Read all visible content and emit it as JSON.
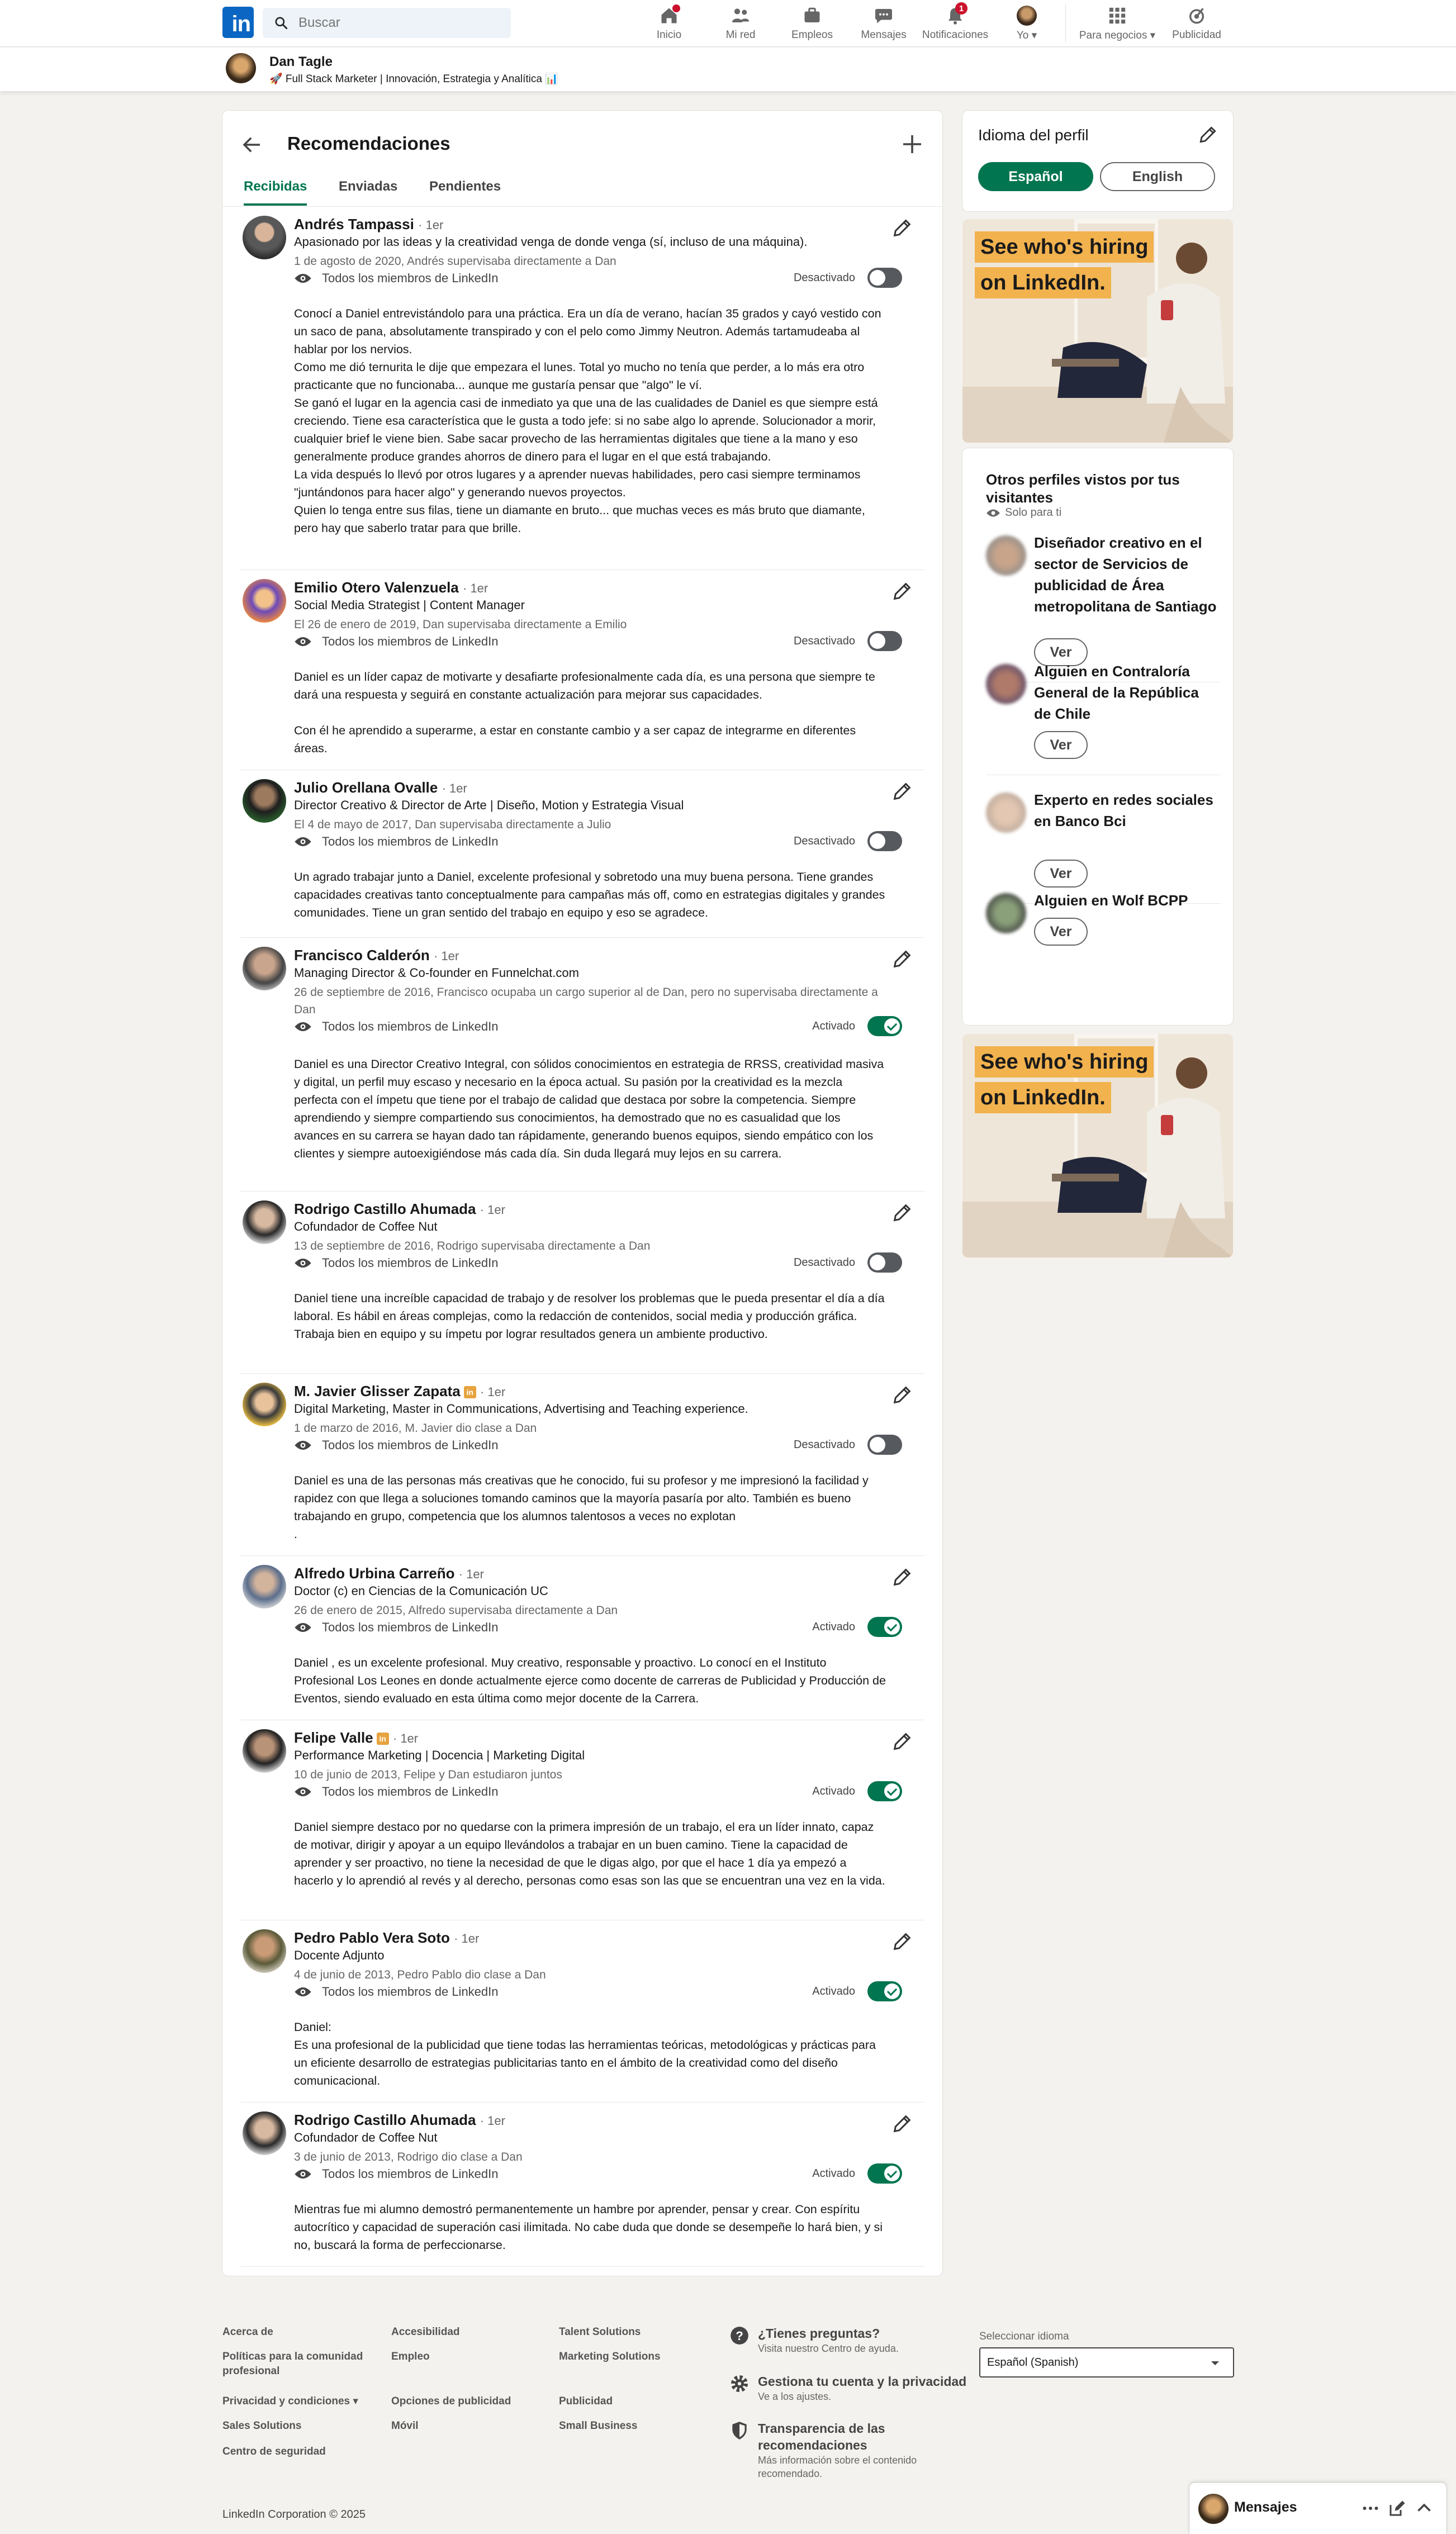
{
  "nav": {
    "logo": "in",
    "search_placeholder": "Buscar",
    "items": [
      {
        "label": "Inicio",
        "icon": "home-icon",
        "badge": ""
      },
      {
        "label": "Mi red",
        "icon": "network-icon",
        "badge": ""
      },
      {
        "label": "Empleos",
        "icon": "briefcase-icon",
        "badge": ""
      },
      {
        "label": "Mensajes",
        "icon": "messaging-icon",
        "badge": ""
      },
      {
        "label": "Notificaciones",
        "icon": "bell-icon",
        "badge": "1"
      },
      {
        "label": "Yo",
        "icon": "avatar",
        "badge": ""
      },
      {
        "label": "Para negocios",
        "icon": "grid-icon",
        "badge": ""
      },
      {
        "label": "Publicidad",
        "icon": "advertise-icon",
        "badge": ""
      }
    ]
  },
  "profile": {
    "name": "Dan Tagle",
    "headline": "🚀 Full Stack Marketer | Innovación, Estrategia y Analítica 📊"
  },
  "main": {
    "title": "Recomendaciones",
    "tabs": [
      "Recibidas",
      "Enviadas",
      "Pendientes"
    ],
    "active_tab": 0,
    "recommendations": [
      {
        "name": "Andrés Tampassi",
        "degree": "· 1er",
        "li_badge": false,
        "headline": "Apasionado por las ideas y la creatividad venga de donde venga (sí, incluso de una máquina).",
        "relation": "1 de agosto de 2020, Andrés supervisaba directamente a Dan",
        "visibility": "Todos los miembros de LinkedIn",
        "state": "Desactivado",
        "on": false,
        "text": "Conocí a Daniel entrevistándolo para una práctica. Era un día de verano, hacían 35 grados y cayó vestido con un saco de pana, absolutamente transpirado y con el pelo como Jimmy Neutron. Además tartamudeaba al hablar por los nervios.\nComo me dió ternurita le dije que empezara el lunes. Total yo mucho no tenía que perder, a lo más era otro practicante que no funcionaba... aunque me gustaría pensar que \"algo\" le ví.\nSe ganó el lugar en la agencia casi de inmediato ya que una de las cualidades de Daniel es que siempre está creciendo. Tiene esa característica que le gusta a todo jefe: si no sabe algo lo aprende. Solucionador a morir, cualquier brief le viene bien. Sabe sacar provecho de las herramientas digitales que tiene a la mano y eso generalmente produce grandes ahorros de dinero para el lugar en el que está trabajando.\nLa vida después lo llevó por otros lugares y a aprender nuevas habilidades, pero casi siempre terminamos \"juntándonos para hacer algo\" y generando nuevos proyectos.\nQuien lo tenga entre sus filas, tiene un diamante en bruto... que muchas veces es más bruto que diamante, pero hay que saberlo tratar para que brille."
      },
      {
        "name": "Emilio Otero Valenzuela",
        "degree": "· 1er",
        "li_badge": false,
        "headline": "Social Media Strategist | Content Manager",
        "relation": "El 26 de enero de 2019, Dan supervisaba directamente a Emilio",
        "visibility": "Todos los miembros de LinkedIn",
        "state": "Desactivado",
        "on": false,
        "text": "Daniel es un líder capaz de motivarte y desafiarte profesionalmente cada día, es una persona que siempre te dará una respuesta y seguirá en constante actualización para mejorar sus capacidades.\n\nCon él he aprendido a superarme, a estar en constante cambio y a ser capaz de integrarme en diferentes áreas."
      },
      {
        "name": "Julio Orellana Ovalle",
        "degree": "· 1er",
        "li_badge": false,
        "headline": "Director Creativo & Director de Arte | Diseño, Motion y Estrategia Visual",
        "relation": "El 4 de mayo de 2017, Dan supervisaba directamente a Julio",
        "visibility": "Todos los miembros de LinkedIn",
        "state": "Desactivado",
        "on": false,
        "text": "Un agrado trabajar junto a Daniel, excelente profesional y sobretodo una muy buena persona. Tiene grandes capacidades creativas tanto conceptualmente para campañas más off, como en estrategias digitales y grandes comunidades. Tiene un gran sentido del trabajo en equipo y eso se agradece."
      },
      {
        "name": "Francisco Calderón",
        "degree": "· 1er",
        "li_badge": false,
        "headline": "Managing Director & Co-founder en Funnelchat.com",
        "relation": "26 de septiembre de 2016, Francisco ocupaba un cargo superior al de Dan, pero no supervisaba directamente a Dan",
        "visibility": "Todos los miembros de LinkedIn",
        "state": "Activado",
        "on": true,
        "text": "Daniel es una Director Creativo Integral, con sólidos conocimientos en estrategia de RRSS, creatividad masiva y digital, un perfil muy escaso y necesario en la época actual. Su pasión por la creatividad es la mezcla perfecta con el ímpetu que tiene por el trabajo de calidad que destaca por sobre la competencia. Siempre aprendiendo y siempre compartiendo sus conocimientos, ha demostrado que no es casualidad que los avances en su carrera se hayan dado tan rápidamente, generando buenos equipos, siendo empático con los clientes y siempre autoexigiéndose más cada día. Sin duda llegará muy lejos en su carrera."
      },
      {
        "name": "Rodrigo Castillo Ahumada",
        "degree": "· 1er",
        "li_badge": false,
        "headline": "Cofundador de Coffee Nut",
        "relation": "13 de septiembre de 2016, Rodrigo supervisaba directamente a Dan",
        "visibility": "Todos los miembros de LinkedIn",
        "state": "Desactivado",
        "on": false,
        "text": "Daniel tiene una increíble capacidad de trabajo y de resolver los problemas que le pueda presentar el día a día laboral. Es hábil en áreas complejas, como la redacción de contenidos, social media y producción gráfica. Trabaja bien en equipo y su ímpetu por lograr resultados genera un ambiente productivo."
      },
      {
        "name": "M. Javier Glisser Zapata",
        "degree": "· 1er",
        "li_badge": true,
        "headline": "Digital Marketing, Master in Communications, Advertising and Teaching experience.",
        "relation": "1 de marzo de 2016, M. Javier dio clase a Dan",
        "visibility": "Todos los miembros de LinkedIn",
        "state": "Desactivado",
        "on": false,
        "text": "Daniel es una de las personas más creativas que he conocido, fui su profesor y me impresionó la facilidad y rapidez con que llega a soluciones tomando caminos que la mayoría pasaría por alto. También es bueno trabajando en grupo, competencia que los alumnos talentosos a veces no explotan\n."
      },
      {
        "name": "Alfredo Urbina Carreño",
        "degree": "· 1er",
        "li_badge": false,
        "headline": "Doctor (c) en Ciencias de la Comunicación UC",
        "relation": "26 de enero de 2015, Alfredo supervisaba directamente a Dan",
        "visibility": "Todos los miembros de LinkedIn",
        "state": "Activado",
        "on": true,
        "text": "Daniel , es un excelente profesional. Muy creativo, responsable y proactivo. Lo conocí en el Instituto Profesional Los Leones en donde actualmente ejerce como docente de carreras de Publicidad y Producción de Eventos, siendo evaluado en esta última como mejor docente de la Carrera."
      },
      {
        "name": "Felipe Valle",
        "degree": "· 1er",
        "li_badge": true,
        "headline": "Performance Marketing | Docencia | Marketing Digital",
        "relation": "10 de junio de 2013, Felipe y Dan estudiaron juntos",
        "visibility": "Todos los miembros de LinkedIn",
        "state": "Activado",
        "on": true,
        "text": "Daniel siempre destaco por no quedarse con la primera impresión de un trabajo, el era un líder innato, capaz de motivar, dirigir y apoyar a un equipo llevándolos a trabajar en un buen camino. Tiene la capacidad de aprender y ser proactivo, no tiene la necesidad de que le digas algo, por que el hace 1 día ya empezó a hacerlo y lo aprendió al revés y al derecho, personas como esas son las que se encuentran una vez en la vida."
      },
      {
        "name": "Pedro Pablo Vera Soto",
        "degree": "· 1er",
        "li_badge": false,
        "headline": "Docente Adjunto",
        "relation": "4 de junio de 2013, Pedro Pablo dio clase a Dan",
        "visibility": "Todos los miembros de LinkedIn",
        "state": "Activado",
        "on": true,
        "text": "Daniel:\nEs una profesional de la publicidad que tiene todas las herramientas teóricas, metodológicas y prácticas para un eficiente desarrollo de estrategias publicitarias tanto en el ámbito de la creatividad como del diseño comunicacional."
      },
      {
        "name": "Rodrigo Castillo Ahumada",
        "degree": "· 1er",
        "li_badge": false,
        "headline": "Cofundador de Coffee Nut",
        "relation": "3 de junio de 2013, Rodrigo dio clase a Dan",
        "visibility": "Todos los miembros de LinkedIn",
        "state": "Activado",
        "on": true,
        "text": "Mientras fue mi alumno demostró permanentemente un hambre por aprender, pensar y crear. Con espíritu autocrítico y capacidad de superación casi ilimitada. No cabe duda que donde se desempeñe lo hará bien, y si no, buscará la forma de perfeccionarse."
      }
    ]
  },
  "language": {
    "title": "Idioma del perfil",
    "options": [
      "Español",
      "English"
    ],
    "selected": 0
  },
  "ad": {
    "line1": "See who's hiring",
    "line2": "on LinkedIn."
  },
  "others": {
    "title": "Otros perfiles vistos por tus visitantes",
    "subtitle": "Solo para ti",
    "button": "Ver",
    "people": [
      "Diseñador creativo en el sector de Servicios de publicidad de Área metropolitana de Santiago",
      "Alguien en Contraloría General de la República de Chile",
      "Experto en redes sociales en Banco Bci",
      "Alguien en Wolf BCPP"
    ]
  },
  "footer": {
    "col1": [
      "Acerca de",
      "Políticas para la comunidad profesional",
      "Privacidad y condiciones",
      "Sales Solutions",
      "Centro de seguridad"
    ],
    "col2": [
      "Accesibilidad",
      "Empleo",
      "Opciones de publicidad",
      "Móvil"
    ],
    "col3": [
      "Talent Solutions",
      "Marketing Solutions",
      "Publicidad",
      "Small Business"
    ],
    "help": [
      {
        "title": "¿Tienes preguntas?",
        "sub": "Visita nuestro Centro de ayuda."
      },
      {
        "title": "Gestiona tu cuenta y la privacidad",
        "sub": "Ve a los ajustes."
      },
      {
        "title": "Transparencia de las recomendaciones",
        "sub": "Más información sobre el contenido recomendado."
      }
    ],
    "lang_label": "Seleccionar idioma",
    "lang_value": "Español (Spanish)",
    "copyright": "LinkedIn Corporation © 2025"
  },
  "messaging": {
    "label": "Mensajes"
  },
  "colors": {
    "brand": "#0a66c2",
    "active": "#01754f",
    "badge": "#cb112d",
    "bg": "#f4f2ee"
  }
}
